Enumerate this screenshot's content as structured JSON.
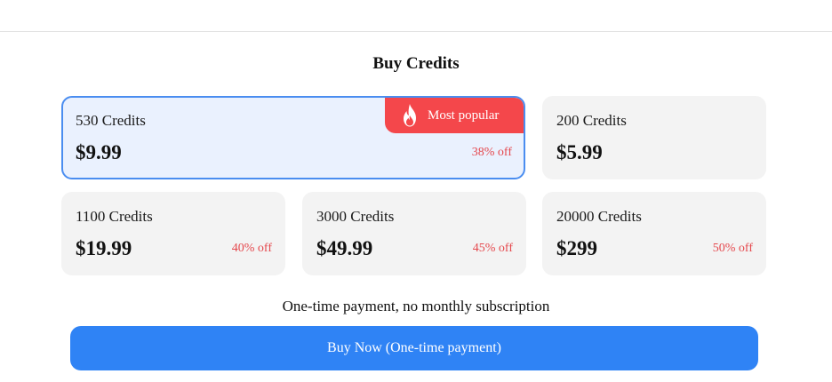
{
  "page": {
    "title": "Buy Credits",
    "note": "One-time payment, no monthly subscription",
    "buy_button_label": "Buy Now (One-time payment)"
  },
  "badge": {
    "label": "Most popular",
    "icon": "fire-icon"
  },
  "packages": [
    {
      "credits": "530 Credits",
      "price": "$9.99",
      "discount": "38% off",
      "selected": true,
      "popular": true
    },
    {
      "credits": "200 Credits",
      "price": "$5.99",
      "discount": "",
      "selected": false
    },
    {
      "credits": "1100 Credits",
      "price": "$19.99",
      "discount": "40% off",
      "selected": false
    },
    {
      "credits": "3000 Credits",
      "price": "$49.99",
      "discount": "45% off",
      "selected": false
    },
    {
      "credits": "20000 Credits",
      "price": "$299",
      "discount": "50% off",
      "selected": false
    }
  ],
  "colors": {
    "accent": "#2f83f5",
    "selected_border": "#4a8df0",
    "selected_bg": "#eaf1fe",
    "badge_bg": "#f4474b",
    "discount": "#e5484d",
    "card_bg": "#f3f3f3"
  }
}
